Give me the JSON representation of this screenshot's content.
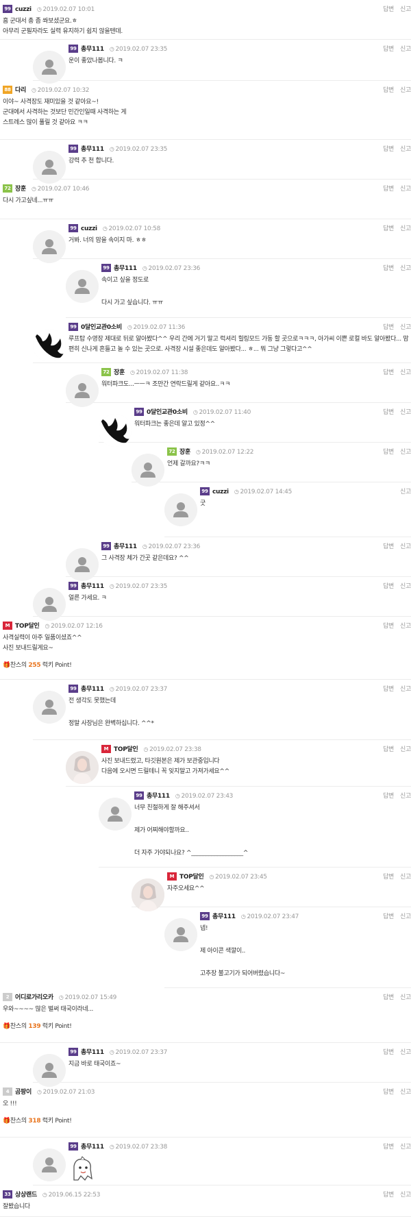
{
  "actions": {
    "reply": "답변",
    "report": "신고"
  },
  "point_text": {
    "prefix": "찬스의",
    "suffix": "럭키 Point!"
  },
  "comments": [
    {
      "level": "99",
      "level_color": "#5a3d8a",
      "nickname": "cuzzi",
      "date": "2019.02.07 10:01",
      "lines": [
        "흠 군대서 총 좀 쏴보셨군요.ㅎ",
        "아무리 군필자라도 실력 유지하기 쉽지 않을텐데."
      ],
      "show_reply": true
    },
    {
      "level": "99",
      "level_color": "#5a3d8a",
      "nickname": "총무111",
      "date": "2019.02.07 23:35",
      "lines": [
        "운이 좋았나봅니다. ㅋ"
      ],
      "show_reply": true
    },
    {
      "level": "88",
      "level_color": "#f0a526",
      "nickname": "다리",
      "date": "2019.02.07 10:32",
      "lines": [
        "이야~ 사격장도 재미있을 것 같아요~!",
        "군대에서 사격하는 것보단 민간인일때 사격하는 게",
        "스트레스 많이 풀릴 것 같아요 ㅋㅋ"
      ],
      "show_reply": true
    },
    {
      "level": "99",
      "level_color": "#5a3d8a",
      "nickname": "총무111",
      "date": "2019.02.07 23:35",
      "lines": [
        "강력 추 천 합니다."
      ],
      "show_reply": true
    },
    {
      "level": "72",
      "level_color": "#8bc34a",
      "nickname": "장훈",
      "date": "2019.02.07 10:46",
      "lines": [
        "다시 가고싶네...ㅠㅠ"
      ],
      "show_reply": true
    },
    {
      "level": "99",
      "level_color": "#5a3d8a",
      "nickname": "cuzzi",
      "date": "2019.02.07 10:58",
      "lines": [
        "거봐. 너의 맘을 속이지 마. ㅎㅎ"
      ],
      "show_reply": true
    },
    {
      "level": "99",
      "level_color": "#5a3d8a",
      "nickname": "총무111",
      "date": "2019.02.07 23:36",
      "lines": [
        "속이고 싶을 정도로",
        "",
        "다시 가고 싶습니다. ㅠㅠ"
      ],
      "show_reply": true
    },
    {
      "level": "99",
      "level_color": "#5a3d8a",
      "nickname": "0달인교관0소비",
      "date": "2019.02.07 11:36",
      "lines": [
        "루프탑 수영장 제대로 뒤로 알아봤다^^ 우리 간에 거기 말고 럭셔리 힐링모드 가동 할 곳으로ㅋㅋㅋ, 아가씨 이쁜 로컬 바도 알아봤다... 맘",
        "편히 신나게 흔들고 놀 수 있는 곳으로. 사격장 시설 좋은데도 알아봤다... ㅎ... 뭐 그냥 그렇다고^^"
      ],
      "show_reply": true
    },
    {
      "level": "72",
      "level_color": "#8bc34a",
      "nickname": "장훈",
      "date": "2019.02.07 11:38",
      "lines": [
        "워터파크도...ㅡㅡㅋ 조만간 연락드릴게 같아요..ㅋㅋ"
      ],
      "show_reply": true
    },
    {
      "level": "99",
      "level_color": "#5a3d8a",
      "nickname": "0달인교관0소비",
      "date": "2019.02.07 11:40",
      "lines": [
        "워터파크는 좋은데 알고 있정^^"
      ],
      "show_reply": true
    },
    {
      "level": "72",
      "level_color": "#8bc34a",
      "nickname": "장훈",
      "date": "2019.02.07 12:22",
      "lines": [
        "언제 갈까요?ㅋㅋ"
      ],
      "show_reply": true
    },
    {
      "level": "99",
      "level_color": "#5a3d8a",
      "nickname": "cuzzi",
      "date": "2019.02.07 14:45",
      "lines": [
        "굿"
      ],
      "show_reply": false
    },
    {
      "level": "99",
      "level_color": "#5a3d8a",
      "nickname": "총무111",
      "date": "2019.02.07 23:36",
      "lines": [
        "그 사격장 체가 간곳 같은데요? ^^"
      ],
      "show_reply": true
    },
    {
      "level": "99",
      "level_color": "#5a3d8a",
      "nickname": "총무111",
      "date": "2019.02.07 23:35",
      "lines": [
        "얼른 가세요. ㅋ"
      ],
      "show_reply": true
    },
    {
      "level": "M",
      "level_color": "#d9263a",
      "nickname": "TOP달인",
      "date": "2019.02.07 12:16",
      "lines": [
        "사격실력이 아주 일품이셨죠^^",
        "사진 보내드릴게요~"
      ],
      "points": "255",
      "show_reply": true
    },
    {
      "level": "99",
      "level_color": "#5a3d8a",
      "nickname": "총무111",
      "date": "2019.02.07 23:37",
      "lines": [
        "전 생각도 못했는데",
        "",
        "정말 사장님은 완벽하십니다. ^^*"
      ],
      "show_reply": true
    },
    {
      "level": "M",
      "level_color": "#d9263a",
      "nickname": "TOP달인",
      "date": "2019.02.07 23:38",
      "lines": [
        "사진 보내드렸고, 타깃원본은 제가 보관중입니다",
        "다음에 오시면 드릴테니 꼭 잊지말고 가져가세요^^"
      ],
      "show_reply": true
    },
    {
      "level": "99",
      "level_color": "#5a3d8a",
      "nickname": "총무111",
      "date": "2019.02.07 23:43",
      "lines": [
        "너무 친절하게 잘 해주셔서",
        "",
        "제가 어찌해야할까요..",
        "",
        "더 자주 가야되나요? ^__________________^"
      ],
      "show_reply": true
    },
    {
      "level": "M",
      "level_color": "#d9263a",
      "nickname": "TOP달인",
      "date": "2019.02.07 23:45",
      "lines": [
        "자주오세요^^"
      ],
      "show_reply": true
    },
    {
      "level": "99",
      "level_color": "#5a3d8a",
      "nickname": "총무111",
      "date": "2019.02.07 23:47",
      "lines": [
        "넵!",
        "",
        "제 아이콘 색깔이..",
        "",
        "고추장 불고기가 되어버렸습니다~"
      ],
      "show_reply": true
    },
    {
      "level": "2",
      "level_color": "#cccccc",
      "nickname": "어디로가리오카",
      "date": "2019.02.07 15:49",
      "lines": [
        "우와~~~~ 많은 벌써 태국이라네..."
      ],
      "points": "139",
      "show_reply": true
    },
    {
      "level": "99",
      "level_color": "#5a3d8a",
      "nickname": "총무111",
      "date": "2019.02.07 23:37",
      "lines": [
        "지금 바로 태국이죠~"
      ],
      "show_reply": true
    },
    {
      "level": "4",
      "level_color": "#cccccc",
      "nickname": "곰팡이",
      "date": "2019.02.07 21:03",
      "lines": [
        "오 !!!"
      ],
      "points": "318",
      "show_reply": true
    },
    {
      "level": "99",
      "level_color": "#5a3d8a",
      "nickname": "총무111",
      "date": "2019.02.07 23:38",
      "lines": [],
      "show_reply": true
    },
    {
      "level": "33",
      "level_color": "#5a3d8a",
      "nickname": "상상랜드",
      "date": "2019.06.15 22:53",
      "lines": [
        "잘봤습니다"
      ],
      "show_reply": true
    }
  ]
}
